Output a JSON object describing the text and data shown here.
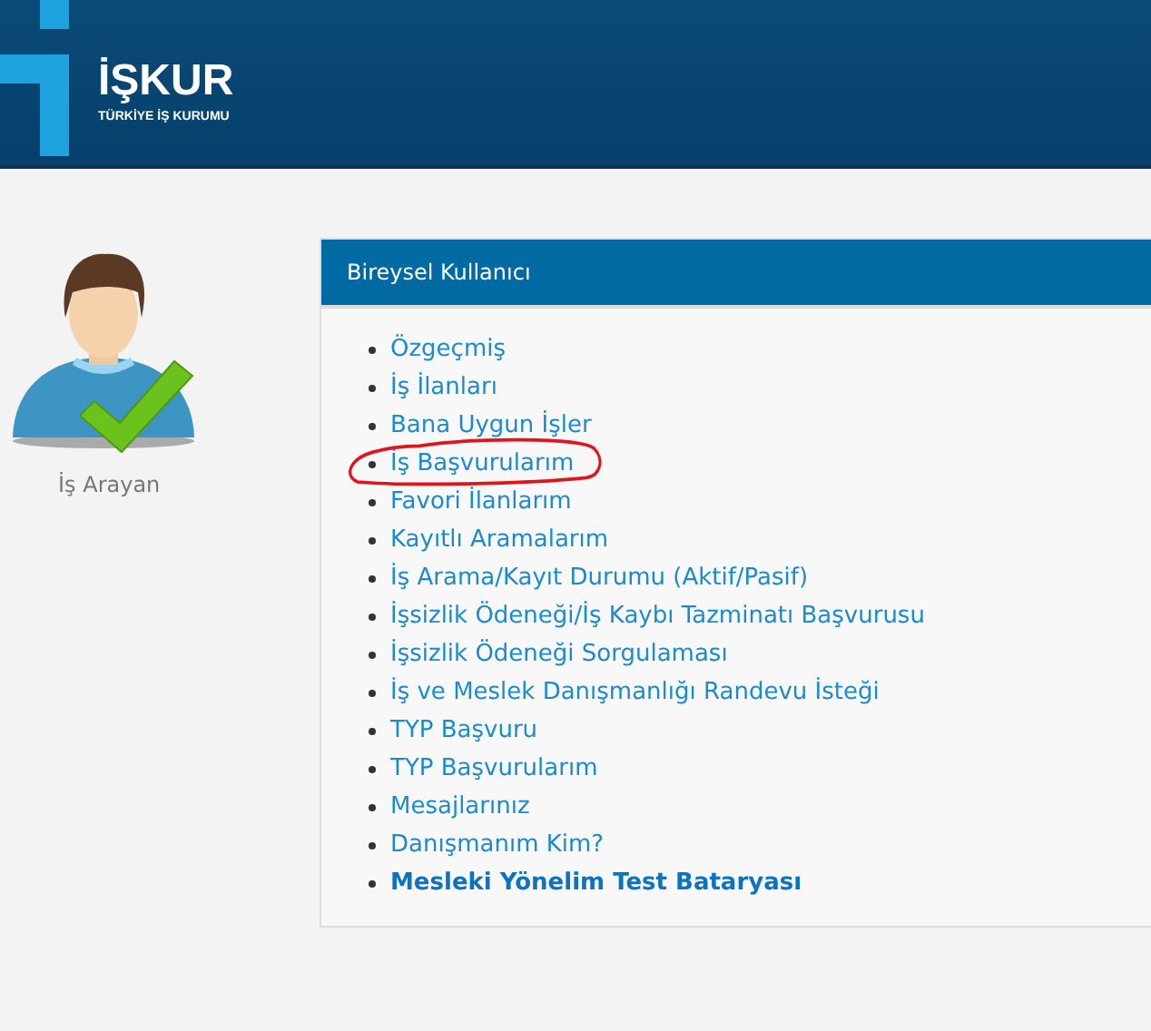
{
  "header": {
    "logo_title": "İŞKUR",
    "logo_subtitle": "TÜRKİYE İŞ KURUMU"
  },
  "user": {
    "label": "İş Arayan"
  },
  "panel": {
    "title": "Bireysel Kullanıcı",
    "items": [
      {
        "label": "Özgeçmiş",
        "bold": false,
        "circled": false
      },
      {
        "label": "İş İlanları",
        "bold": false,
        "circled": false
      },
      {
        "label": "Bana Uygun İşler",
        "bold": false,
        "circled": false
      },
      {
        "label": "İş Başvurularım",
        "bold": false,
        "circled": true
      },
      {
        "label": "Favori İlanlarım",
        "bold": false,
        "circled": false
      },
      {
        "label": "Kayıtlı Aramalarım",
        "bold": false,
        "circled": false
      },
      {
        "label": "İş Arama/Kayıt Durumu (Aktif/Pasif)",
        "bold": false,
        "circled": false
      },
      {
        "label": "İşsizlik Ödeneği/İş Kaybı Tazminatı Başvurusu",
        "bold": false,
        "circled": false
      },
      {
        "label": "İşsizlik Ödeneği Sorgulaması",
        "bold": false,
        "circled": false
      },
      {
        "label": "İş ve Meslek Danışmanlığı Randevu İsteği",
        "bold": false,
        "circled": false
      },
      {
        "label": "TYP Başvuru",
        "bold": false,
        "circled": false
      },
      {
        "label": "TYP Başvurularım",
        "bold": false,
        "circled": false
      },
      {
        "label": "Mesajlarınız",
        "bold": false,
        "circled": false
      },
      {
        "label": "Danışmanım Kim?",
        "bold": false,
        "circled": false
      },
      {
        "label": "Mesleki Yönelim Test Bataryası",
        "bold": true,
        "circled": false
      }
    ]
  }
}
